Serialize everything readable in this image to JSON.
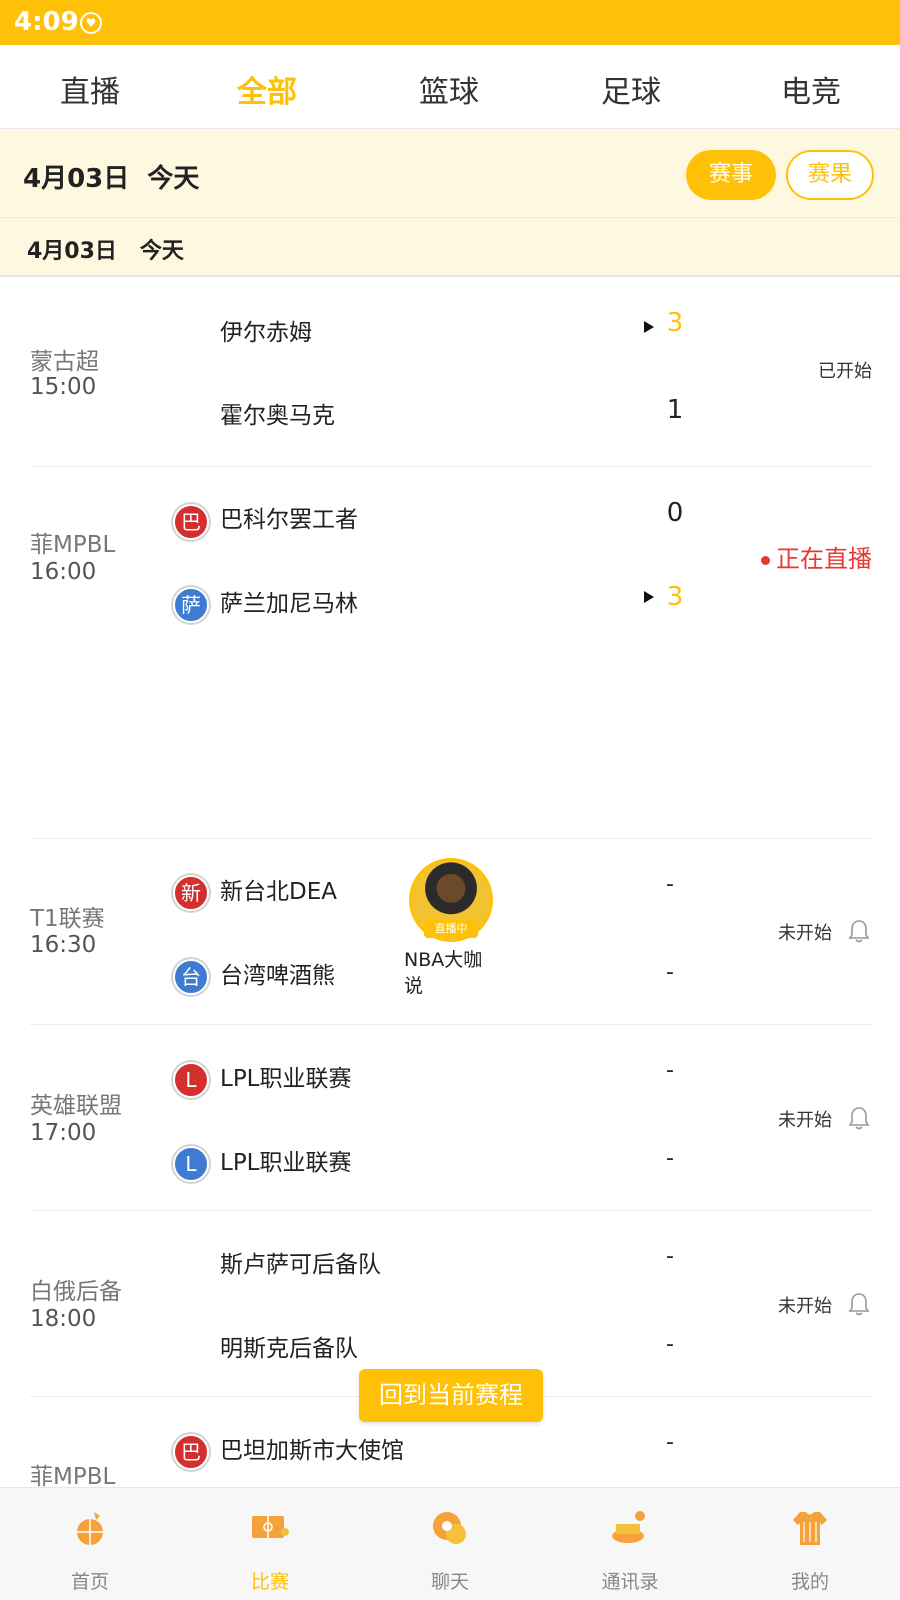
{
  "status_bar": {
    "time": "4:09"
  },
  "tabs": [
    {
      "label": "直播"
    },
    {
      "label": "全部"
    },
    {
      "label": "篮球"
    },
    {
      "label": "足球"
    },
    {
      "label": "电竞"
    }
  ],
  "active_tab": "全部",
  "date_header": {
    "date": "4月03日  今天",
    "events_button": "赛事",
    "results_button": "赛果"
  },
  "section_date": "4月03日   今天",
  "matches": [
    {
      "league": "蒙古超",
      "time": "15:00",
      "home": {
        "name": "伊尔赤姆",
        "score": "3",
        "winner": true,
        "logo": ""
      },
      "away": {
        "name": "霍尔奥马克",
        "score": "1",
        "winner": false,
        "logo": ""
      },
      "status": "已开始"
    },
    {
      "league": "菲MPBL",
      "time": "16:00",
      "home": {
        "name": "巴科尔罢工者",
        "score": "0",
        "winner": false,
        "logo": "巴"
      },
      "away": {
        "name": "萨兰加尼马林",
        "score": "3",
        "winner": true,
        "logo": "萨"
      },
      "status": "正在直播",
      "host": {
        "name": "NBA大咖说",
        "badge": "直播中"
      }
    },
    {
      "league": "T1联赛",
      "time": "16:30",
      "home": {
        "name": "新台北DEA",
        "score": "-",
        "logo": "新"
      },
      "away": {
        "name": "台湾啤酒熊",
        "score": "-",
        "logo": "台"
      },
      "status": "未开始"
    },
    {
      "league": "英雄联盟",
      "time": "17:00",
      "home": {
        "name": "LPL职业联赛",
        "score": "-",
        "logo": "L"
      },
      "away": {
        "name": "LPL职业联赛",
        "score": "-",
        "logo": "L"
      },
      "status": "未开始"
    },
    {
      "league": "白俄后备",
      "time": "18:00",
      "home": {
        "name": "斯卢萨可后备队",
        "score": "-",
        "logo": ""
      },
      "away": {
        "name": "明斯克后备队",
        "score": "-",
        "logo": ""
      },
      "status": "未开始"
    },
    {
      "league": "菲MPBL",
      "time": "",
      "home": {
        "name": "巴坦加斯市大使馆",
        "score": "-",
        "logo": "巴"
      }
    }
  ],
  "back_to_current": "回到当前赛程",
  "bottom_nav": [
    {
      "label": "首页",
      "icon": "home-basketball-icon"
    },
    {
      "label": "比赛",
      "icon": "court-icon"
    },
    {
      "label": "聊天",
      "icon": "chat-icon"
    },
    {
      "label": "通讯录",
      "icon": "contacts-icon"
    },
    {
      "label": "我的",
      "icon": "jersey-icon"
    }
  ],
  "colors": {
    "accent": "#FFC107",
    "live": "#E53935",
    "band": "#FFF8E1"
  }
}
